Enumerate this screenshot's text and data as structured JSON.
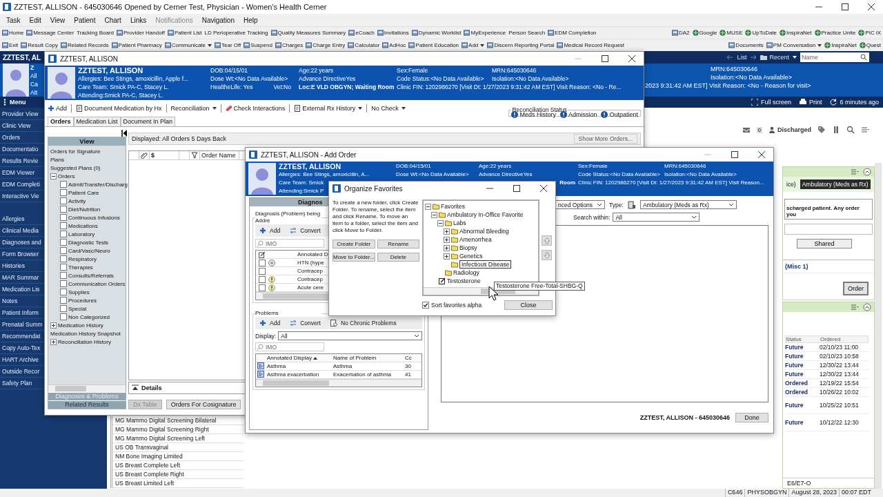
{
  "app": {
    "title": "ZZTEST, ALLISON - 645030646 Opened by Cerner Test, Physician - Women's Health Cerner"
  },
  "menu": [
    {
      "label": "Task",
      "disabled": false
    },
    {
      "label": "Edit",
      "disabled": false
    },
    {
      "label": "View",
      "disabled": false
    },
    {
      "label": "Patient",
      "disabled": false
    },
    {
      "label": "Chart",
      "disabled": false
    },
    {
      "label": "Links",
      "disabled": false
    },
    {
      "label": "Notifications",
      "disabled": true
    },
    {
      "label": "Navigation",
      "disabled": false
    },
    {
      "label": "Help",
      "disabled": false
    }
  ],
  "toolbar_1": {
    "left": [
      {
        "label": "Home",
        "kind": "app"
      },
      {
        "label": "Message Center",
        "kind": "app"
      },
      {
        "label": "Tracking Board",
        "kind": "text"
      },
      {
        "label": "Provider Handoff",
        "kind": "app"
      },
      {
        "label": "Patient List",
        "kind": "app"
      },
      {
        "label": "LD Perioperative Tracking",
        "kind": "text"
      },
      {
        "label": "Quality Measures Summary",
        "kind": "app"
      },
      {
        "label": "eCoach",
        "kind": "app"
      },
      {
        "label": "Invitations",
        "kind": "app"
      },
      {
        "label": "Dynamic Worklist",
        "kind": "app"
      },
      {
        "label": "MyExperience",
        "kind": "app"
      },
      {
        "label": "Person Search",
        "kind": "text"
      },
      {
        "label": "EDM Completion",
        "kind": "app"
      }
    ],
    "right": [
      {
        "label": "DA2",
        "kind": "app"
      },
      {
        "label": "Google",
        "kind": "web"
      },
      {
        "label": "MUSE",
        "kind": "web"
      },
      {
        "label": "UpToDate",
        "kind": "web"
      },
      {
        "label": "InspiraNet",
        "kind": "web"
      },
      {
        "label": "Practice Unite",
        "kind": "web"
      },
      {
        "label": "PIC iX",
        "kind": "web"
      }
    ]
  },
  "toolbar_2": {
    "left": [
      {
        "label": "Exit",
        "kind": "app"
      },
      {
        "label": "Result Copy",
        "kind": "app"
      },
      {
        "label": "Related Records",
        "kind": "app"
      },
      {
        "label": "Patient Pharmacy",
        "kind": "app"
      },
      {
        "label": "Communicate",
        "kind": "app",
        "dropdown": true
      },
      {
        "label": "Tear Off",
        "kind": "app"
      },
      {
        "label": "Suspend",
        "kind": "app"
      },
      {
        "label": "Charges",
        "kind": "app"
      },
      {
        "label": "Charge Entry",
        "kind": "app"
      },
      {
        "label": "Calculator",
        "kind": "app"
      },
      {
        "label": "AdHoc",
        "kind": "app"
      },
      {
        "label": "Patient Education",
        "kind": "app"
      },
      {
        "label": "Add",
        "kind": "app",
        "dropdown": true
      },
      {
        "label": "Discern Reporting Portal",
        "kind": "app"
      },
      {
        "label": "Medical Record Request",
        "kind": "app"
      }
    ],
    "right": [
      {
        "label": "Documents",
        "kind": "app"
      },
      {
        "label": "PM Conversation",
        "kind": "app",
        "dropdown": true
      },
      {
        "label": "InspiraNet",
        "kind": "web"
      },
      {
        "label": "Quest",
        "kind": "web"
      }
    ]
  },
  "chart": {
    "banner_name": "ZZTEST, AL",
    "banner_fragments": [
      "Z",
      "All",
      "Ca",
      "Att"
    ],
    "nav": {
      "list": "List",
      "recent": "Recent",
      "search_placeholder": "Name"
    },
    "banner_info": [
      "MRN:645030646",
      "Isolation:<No Data Available>",
      "2023 9:31:42 AM EST] Visit Reason: <No - Reason for visit>"
    ],
    "menu_title": "Menu",
    "menu_groups": [
      [
        "Provider View",
        "Clinic View",
        "Orders",
        "Documentatio",
        "Results Revie",
        "EDM Viewer",
        "EDM Completi",
        "Interactive Vie"
      ],
      [
        "Allergies",
        "Clinical Media",
        "Diagnoses and",
        "Form Browser",
        "Histories",
        "MAR Summar",
        "Medication Lis",
        "Notes",
        "Patient Inform",
        "Prenatal Summ",
        "Recommendat",
        "Copy Auto-Tex",
        "HART Archive",
        "Outside Recor",
        "Safety Plan"
      ]
    ],
    "actions": [
      "Full screen",
      "Print",
      "6 minutes ago"
    ],
    "inbox_count": "0",
    "encounter_status": "Discharged",
    "order_panel": {
      "tabs": [
        {
          "label": "ice)",
          "selected": false
        },
        {
          "label": "Ambulatory (Meds as Rx)",
          "selected": true
        }
      ],
      "message": "scharged patient. Any order you",
      "shared": "Shared",
      "misc": "(Misc 1)",
      "order_button": "Order"
    },
    "orders_panel": {
      "columns": [
        "Status",
        "Ordered"
      ],
      "rows": [
        [
          "Future",
          "02/10/23 11:00"
        ],
        [
          "Future",
          "02/10/23 10:58"
        ],
        [
          "Future",
          "12/30/22 13:44"
        ],
        [
          "Future",
          "12/30/22 13:44"
        ],
        [
          "Ordered",
          "12/19/22 15:54"
        ],
        [
          "Ordered",
          "10/26/22 10:02"
        ],
        [
          "Future",
          "10/25/22 10:51"
        ],
        [
          "Future",
          "10/12/22 12:30"
        ]
      ],
      "footer": "E6/E7-O"
    },
    "results_list": [
      "MG Mammo Digital Screening Bilateral",
      "MG Mammo Digital Screening Right",
      "MG Mammo Digital Screening Left",
      "US OB Transvaginal",
      "NM Bone Imaging Limited",
      "US Breast Complete Left",
      "US Breast Complete Right",
      "US Breast Limited Left"
    ]
  },
  "status_bar": [
    "C646",
    "PHYSOBGYN",
    "August 28, 2023",
    "00:07 EDT"
  ],
  "orders_window": {
    "title": "ZZTEST, ALLISON",
    "banner": {
      "name": "ZZTEST, ALLISON",
      "allergies": "Allergies: Bee Stings, amoxicillin, Apple f...",
      "care_team": "Care Team: Smick PA-C, Stacey L.",
      "attending": "Attending:Smick PA-C, Stacey L.",
      "dob": "DOB:04/15/01",
      "dose_wt": "Dose Wt:<No Data Available>",
      "healthelife": "HealtheLife: Yes",
      "vet": "Vet:No",
      "age": "Age:22 years",
      "advance_directive": "Advance DirectiveYes",
      "location": "Loc:E VLD OBGYN; Waiting Room",
      "sex": "Sex:Female",
      "code_status": "Code Status:<No Data Available>",
      "clinic_fin": "Clinic FIN: 1202986270 [Visit Dt: 1/27/2023 9:31:42 AM EST] Visit Reason: <No - Re...",
      "mrn": "MRN:645030646",
      "isolation": "Isolation:<No Data Available>"
    },
    "toolbar": [
      {
        "label": "Add",
        "kind": "add"
      },
      {
        "label": "Document Medication by Hx",
        "kind": "doc"
      },
      {
        "label": "Reconciliation",
        "kind": "text",
        "dropdown": true
      },
      {
        "label": "Check Interactions",
        "kind": "pill"
      },
      {
        "label": "External Rx History",
        "kind": "doc",
        "dropdown": true
      },
      {
        "label": "No Check",
        "kind": "text",
        "dropdown": true
      }
    ],
    "reconciliation": {
      "title": "Reconciliation Status",
      "items": [
        "Meds History",
        "Admission",
        "Outpatient"
      ]
    },
    "tabs": [
      {
        "label": "Orders",
        "selected": true
      },
      {
        "label": "Medication List",
        "selected": false
      },
      {
        "label": "Document In Plan",
        "selected": false
      }
    ],
    "view": {
      "title": "View",
      "tree": [
        {
          "label": "Orders for Signature"
        },
        {
          "label": "Plans"
        },
        {
          "label": "Suggested Plans (0)"
        },
        {
          "label": "Orders",
          "expanded": true,
          "children": [
            {
              "label": "Admit/Transfer/Discharg",
              "checked": false
            },
            {
              "label": "Patient Care",
              "checked": false
            },
            {
              "label": "Activity",
              "checked": false
            },
            {
              "label": "Diet/Nutrition",
              "checked": false
            },
            {
              "label": "Continuous Infusions",
              "checked": false
            },
            {
              "label": "Medications",
              "checked": false
            },
            {
              "label": "Laboratory",
              "checked": false
            },
            {
              "label": "Diagnostic Tests",
              "checked": false
            },
            {
              "label": "Card/Vasc/Neuro",
              "checked": false
            },
            {
              "label": "Respiratory",
              "checked": false
            },
            {
              "label": "Therapies",
              "checked": false
            },
            {
              "label": "Consults/Referrals",
              "checked": false
            },
            {
              "label": "Communication Orders",
              "checked": false
            },
            {
              "label": "Supplies",
              "checked": false
            },
            {
              "label": "Procedures",
              "checked": false
            },
            {
              "label": "Special",
              "checked": false
            },
            {
              "label": "Non Categorized",
              "checked": false
            }
          ]
        },
        {
          "label": "Medication History",
          "expanded": false
        },
        {
          "label": "Medication History Snapshot"
        },
        {
          "label": "Reconciliation History",
          "expanded": false
        }
      ],
      "sections": [
        "Diagnoses & Problems",
        "Related Results"
      ]
    },
    "displayed": "Displayed: All Orders 5 Days Back",
    "show_more": "Show More Orders...",
    "columns": [
      "$",
      "Order Name"
    ],
    "details": "Details",
    "buttons": [
      {
        "label": "Dx Table",
        "disabled": true
      },
      {
        "label": "Orders For Cosignature",
        "disabled": false
      }
    ]
  },
  "add_order_window": {
    "title": "ZZTEST, ALLISON - Add Order",
    "banner": {
      "name": "ZZTEST, ALLISON",
      "allergies": "Allergies: Bee Stings, amoxicillin, A...",
      "care_team": "Care Team: Smick",
      "attending": "Attending:Smick P",
      "dob": "DOB:04/15/01",
      "dose_wt": "Dose Wt:<No Data Available>",
      "age": "Age:22 years",
      "advance_directive": "Advance DirectiveYes",
      "location": "Room",
      "sex": "Sex:Female",
      "code_status": "Code Status:<No Data Available>",
      "clinic_fin": "Clinic FIN: 1202986270 [Visit Dt: 1/27/2023 9:31:42 AM EST] Visit Reason...",
      "mrn": "MRN:645030646",
      "isolation": "Isolation:<No Data Available>"
    },
    "diagnosis": {
      "header": "Diagnos",
      "legend": "Diagnosis (Problem) being Addre",
      "actions": [
        "Add",
        "Convert"
      ],
      "search_placeholder": "IMO",
      "column": "Annotated D",
      "rows": [
        {
          "text": "HTN (hype",
          "kind": "info",
          "checked": false
        },
        {
          "text": "Contracep",
          "kind": "none",
          "checked": false
        },
        {
          "text": "Contracep",
          "kind": "alert",
          "checked": false
        },
        {
          "text": "Acute cere",
          "kind": "alert",
          "checked": false
        }
      ]
    },
    "problems": {
      "legend": "Problems",
      "actions": [
        "Add",
        "Convert",
        "No Chronic Problems"
      ],
      "display_label": "Display:",
      "display_value": "All",
      "search_placeholder": "IMO",
      "columns": [
        "Annotated Display",
        "Name of Problem",
        "Cc"
      ],
      "rows": [
        [
          "Asthma",
          "Asthma",
          "30"
        ],
        [
          "Asthma exacerbation",
          "Exacerbation of asthma",
          "41"
        ]
      ]
    },
    "options": "nced Options",
    "type_label": "Type:",
    "type_value": "Ambulatory (Meds as Rx)",
    "search_within_label": "Search within:",
    "search_within_value": "All",
    "footer": "ZZTEST, ALLISON - 645030646",
    "done": "Done"
  },
  "organize_favorites": {
    "title": "Organize Favorites",
    "instructions": "To create a new folder, click Create Folder. To rename, select the item and click Rename. To move an item to a folder, select the item and click Move to Folder.",
    "buttons": [
      "Create Folder",
      "Rename",
      "Move to Folder...",
      "Delete"
    ],
    "tree": [
      {
        "label": "Favorites",
        "kind": "folder",
        "editing": false,
        "expanded": true,
        "children": [
          {
            "label": "Ambulatory In-Office Favorite",
            "kind": "folder",
            "editing": false,
            "expanded": true,
            "children": [
              {
                "label": "Labs",
                "kind": "folder",
                "editing": false,
                "expanded": true,
                "children": [
                  {
                    "label": "Abnormal Bleeding",
                    "kind": "folder",
                    "editing": false,
                    "expanded": false
                  },
                  {
                    "label": "Amenorrhea",
                    "kind": "folder",
                    "editing": false,
                    "expanded": false
                  },
                  {
                    "label": "Biopsy",
                    "kind": "folder",
                    "editing": false,
                    "expanded": false
                  },
                  {
                    "label": "Genetics",
                    "kind": "folder",
                    "editing": false,
                    "expanded": false
                  },
                  {
                    "label": "Infectious Disease",
                    "kind": "folder",
                    "editing": true
                  }
                ]
              },
              {
                "label": "Radiology",
                "kind": "folder",
                "editing": false
              }
            ]
          },
          {
            "label": "Testosterone",
            "kind": "order",
            "editing": false
          }
        ]
      }
    ],
    "tooltip": "Testosterone Free-Total-SHBG-Q",
    "sort_alpha": {
      "label": "Sort favorites alpha",
      "checked": true
    },
    "close": "Close"
  }
}
